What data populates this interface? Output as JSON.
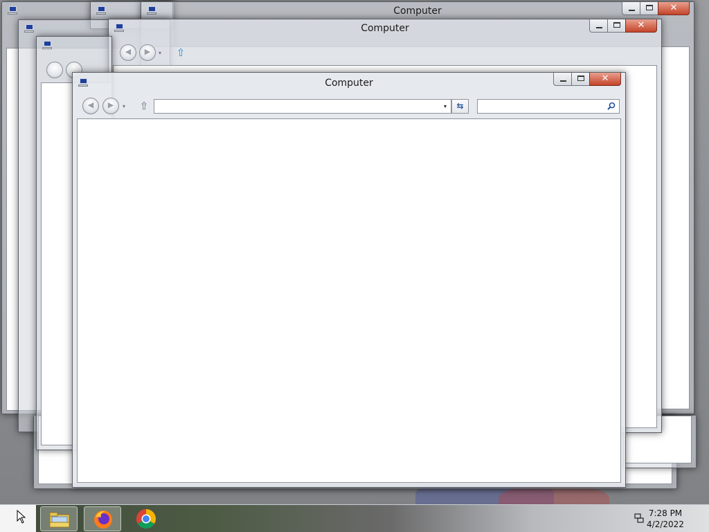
{
  "windows": {
    "back_1": {
      "title": "Computer"
    },
    "back_2": {
      "title": "Computer"
    },
    "front": {
      "title": "Computer",
      "address_value": "",
      "search_placeholder": ""
    }
  },
  "caption_glyphs": {
    "close": "✕"
  },
  "nav_glyphs": {
    "up": "⇧",
    "dropdown": "▾",
    "refresh": "⇆"
  },
  "taskbar": {
    "apps": [
      {
        "name": "File Explorer",
        "icon": "folder-icon"
      },
      {
        "name": "Firefox",
        "icon": "firefox-icon"
      },
      {
        "name": "Chrome",
        "icon": "chrome-icon"
      }
    ],
    "clock_time": "7:28 PM",
    "clock_date": "4/2/2022"
  },
  "colors": {
    "close_red": "#c4442a",
    "title_text": "#1a1a1a",
    "content_bg": "#ffffff"
  }
}
